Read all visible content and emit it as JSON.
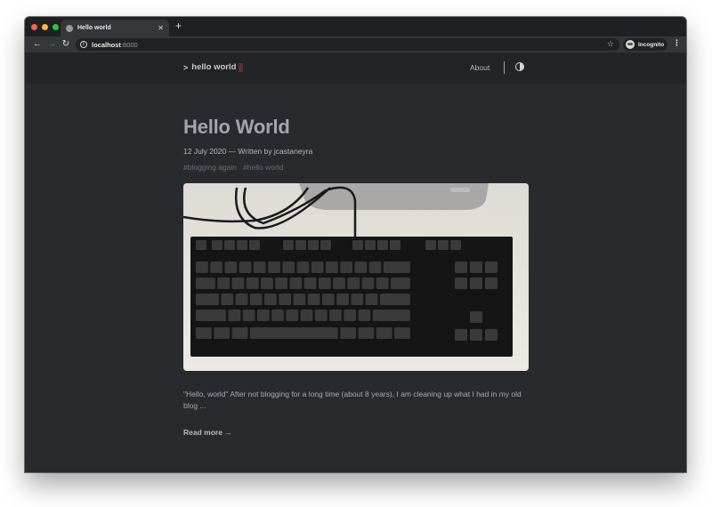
{
  "browser": {
    "tab": {
      "title": "Hello world",
      "close_glyph": "✕"
    },
    "new_tab_glyph": "+",
    "nav": {
      "back_glyph": "←",
      "forward_glyph": "→",
      "reload_glyph": "↻"
    },
    "address": {
      "host": "localhost",
      "port": ":8000",
      "info_glyph": "i"
    },
    "star_glyph": "☆",
    "profile_label": "Incognito",
    "menu_glyph": "⋮"
  },
  "site": {
    "logo_caret": ">",
    "logo_text": "hello world",
    "nav": {
      "about": "About"
    },
    "cursor_color": "#5a2e36"
  },
  "post": {
    "title": "Hello World",
    "meta": "12 July 2020 — Written by jcastaneyra",
    "tags": [
      "#blogging again",
      "#hello world"
    ],
    "image_alt": "Black tenkeyless mechanical keyboard on a white desk",
    "excerpt": "\"Hello, world\" After not blogging for a long time (about 8 years), I am cleaning up what I had in my old blog ...",
    "read_more": "Read more →"
  }
}
